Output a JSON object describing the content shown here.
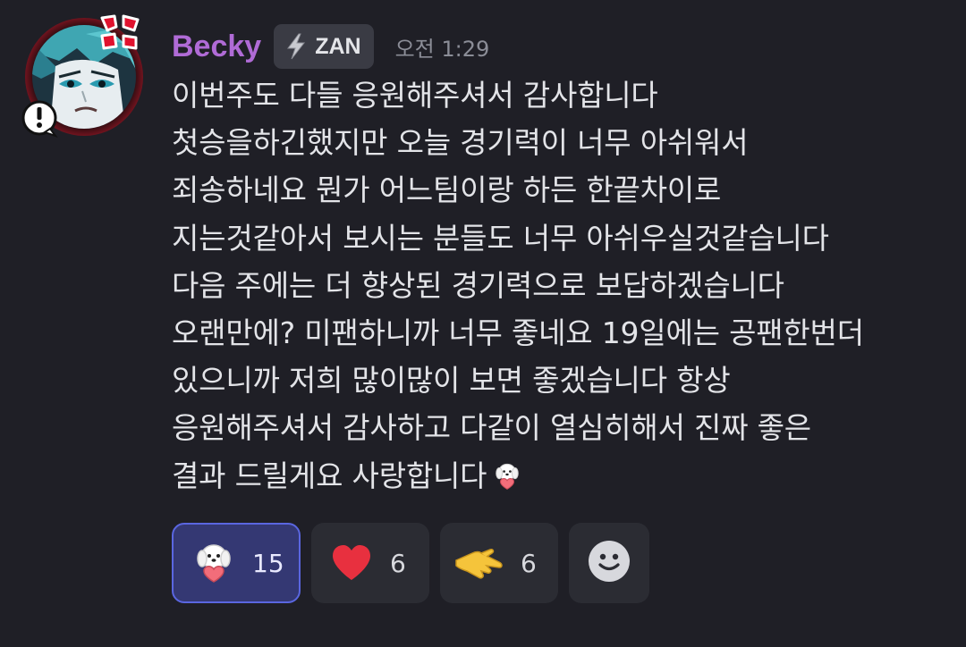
{
  "message": {
    "author": {
      "name": "Becky",
      "name_color": "#b06bd6",
      "avatar_icon": "anime-character-avatar",
      "decoration_icons": [
        "anger-symbol-icon",
        "exclamation-bubble-icon"
      ]
    },
    "tag": {
      "icon": "lightning-icon",
      "label": "ZAN"
    },
    "timestamp": "오전 1:29",
    "lines": [
      "이번주도 다들 응원해주셔서 감사합니다",
      "첫승을하긴했지만 오늘 경기력이 너무 아쉬워서",
      "죄송하네요 뭔가 어느팀이랑 하든 한끝차이로",
      "지는것같아서 보시는 분들도 너무 아쉬우실것같습니다",
      "다음 주에는 더 향상된 경기력으로 보답하겠습니다",
      "오랜만에? 미팬하니까 너무 좋네요 19일에는 공팬한번더",
      "있으니까 저희 많이많이 보면 좋겠습니다 항상",
      "응원해주셔서 감사하고 다같이 열심히해서 진짜 좋은",
      "결과 드릴게요 사랑합니다"
    ],
    "inline_emoji": "puppy-heart-emoji"
  },
  "reactions": [
    {
      "emoji": "puppy-heart-emoji",
      "count": "15",
      "selected": true
    },
    {
      "emoji": "red-heart-emoji",
      "count": "6",
      "selected": false
    },
    {
      "emoji": "pointing-hand-emoji",
      "count": "6",
      "selected": false
    }
  ],
  "add_reaction": {
    "icon": "smiley-add-reaction-icon"
  },
  "colors": {
    "background": "#1f1f26",
    "text": "#e3e4e8",
    "timestamp": "#8b8d97",
    "reaction_bg": "#2b2c33",
    "reaction_selected_bg": "#343873",
    "reaction_selected_border": "#5a66e0",
    "tag_bg": "#3a3b44"
  }
}
